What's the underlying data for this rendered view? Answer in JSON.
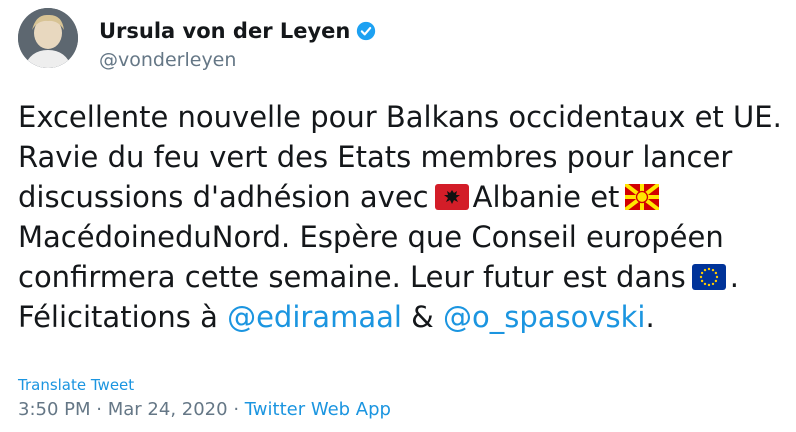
{
  "author": {
    "display_name": "Ursula von der Leyen",
    "handle": "@vonderleyen",
    "verified_icon": "verified-badge-icon",
    "avatar_icon": "profile-photo"
  },
  "tweet": {
    "line1": "Excellente nouvelle pour Balkans occidentaux et UE.",
    "line2": "Ravie du feu vert des Etats membres pour lancer",
    "line3_pre": "discussions d'adhésion avec",
    "albania_flag_icon": "albania-flag-icon",
    "line3_mid": "Albanie et",
    "north_macedonia_flag_icon": "north-macedonia-flag-icon",
    "line4": "MacédoineduNord. Espère que Conseil européen",
    "line5_pre": "confirmera cette semaine. Leur futur est dans",
    "eu_flag_icon": "eu-flag-icon",
    "line5_post": ".",
    "line6_pre": "Félicitations à",
    "mention_1": "@ediramaal",
    "and": "&",
    "mention_2": "@o_spasovski",
    "line6_post": "."
  },
  "footer": {
    "translate_label": "Translate Tweet",
    "time": "3:50 PM",
    "sep1": "·",
    "date": "Mar 24, 2020",
    "sep2": "·",
    "source_app": "Twitter Web App"
  },
  "colors": {
    "link": "#1b95e0",
    "secondary": "#657786",
    "text": "#14171a"
  }
}
